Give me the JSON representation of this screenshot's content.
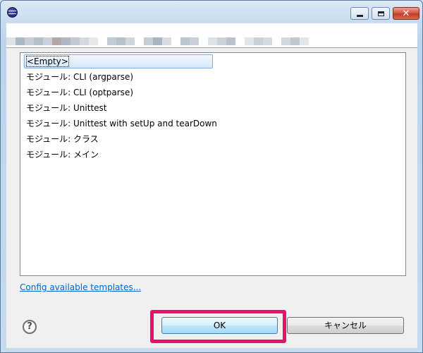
{
  "window": {
    "title": "",
    "controls": {
      "minimize": "minimize",
      "maximize": "maximize",
      "close": "✕"
    }
  },
  "header": {
    "blurred_strip_colors": [
      "#dbe2ea",
      "#a9b7c9",
      "#c7ced8",
      "#b4bfcc",
      "#c9d2dc",
      "#b2a7a7",
      "#aeb7c2",
      "#c2c9d3",
      "#d4d9df",
      "#e6e9ec",
      "#ffffff",
      "#c3cbd6",
      "#b7c1cd",
      "#d0d6de",
      "#ffffff",
      "#c6cdd6",
      "#a9b4c2",
      "#d8dde3",
      "#ffffff",
      "#bcc6d1",
      "#c9d0d8",
      "#ffffff",
      "#dde2e8",
      "#cbd2da",
      "#b9c3ce",
      "#ffffff",
      "#e1e5ea",
      "#c8cfd8",
      "#d6dbe1",
      "#ffffff",
      "#d3d9e0",
      "#c0c8d2",
      "#e2e6ea"
    ]
  },
  "templates": {
    "items": [
      {
        "label": "<Empty>",
        "selected": true
      },
      {
        "label": "モジュール: CLI (argparse)",
        "selected": false
      },
      {
        "label": "モジュール: CLI (optparse)",
        "selected": false
      },
      {
        "label": "モジュール: Unittest",
        "selected": false
      },
      {
        "label": "モジュール: Unittest with setUp and tearDown",
        "selected": false
      },
      {
        "label": "モジュール: クラス",
        "selected": false
      },
      {
        "label": "モジュール: メイン",
        "selected": false
      }
    ]
  },
  "footer": {
    "config_link": "Config available templates...",
    "help_glyph": "?",
    "ok_label": "OK",
    "cancel_label": "キャンセル"
  },
  "colors": {
    "highlight": "#e8106a",
    "link": "#0066cc",
    "selection_border": "#84acdd"
  }
}
